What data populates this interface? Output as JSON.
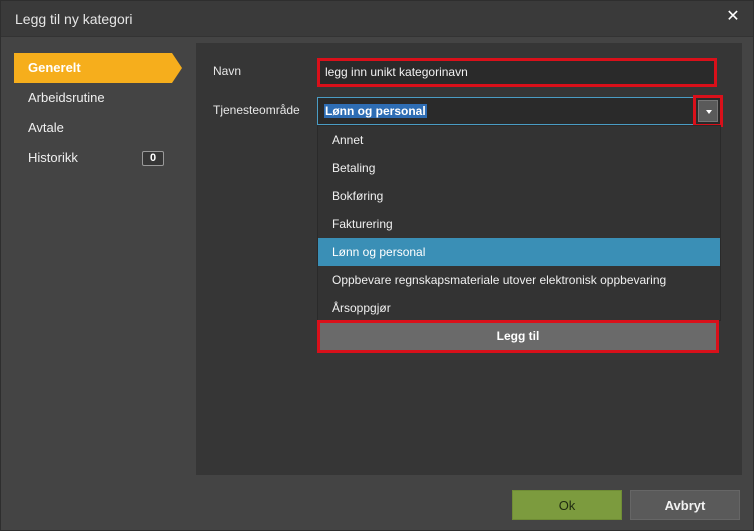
{
  "dialog": {
    "title": "Legg til ny kategori",
    "close_symbol": "✕"
  },
  "sidebar": {
    "items": [
      {
        "label": "Generelt",
        "active": true
      },
      {
        "label": "Arbeidsrutine"
      },
      {
        "label": "Avtale"
      },
      {
        "label": "Historikk",
        "badge": "0"
      }
    ]
  },
  "form": {
    "navn_label": "Navn",
    "navn_value": "legg inn unikt kategorinavn",
    "tjeneste_label": "Tjenesteområde",
    "tjeneste_selected": "Lønn og personal",
    "options": [
      "Annet",
      "Betaling",
      "Bokføring",
      "Fakturering",
      "Lønn og personal",
      "Oppbevare regnskapsmateriale utover elektronisk oppbevaring",
      "Årsoppgjør"
    ],
    "add_label": "Legg til"
  },
  "footer": {
    "ok_label": "Ok",
    "cancel_label": "Avbryt"
  },
  "colors": {
    "accent": "#f6ae1c",
    "highlight": "#d9101a",
    "selected": "#3a8fb6",
    "ok": "#7c9b3e"
  },
  "icons": {
    "close": "close-icon",
    "dropdown": "chevron-down-icon"
  }
}
